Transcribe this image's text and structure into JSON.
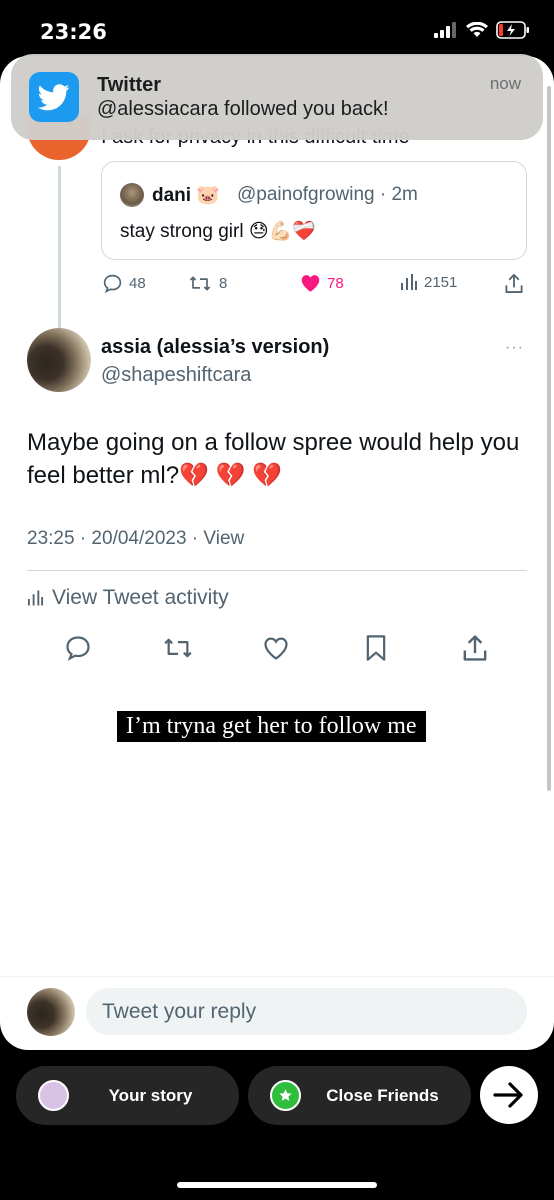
{
  "status_bar": {
    "time": "23:26"
  },
  "notification": {
    "app": "Twitter",
    "message": "@alessiacara followed you back!",
    "time": "now",
    "icon": "twitter-bird-icon"
  },
  "previous_tweet": {
    "partial_text": "I ask for privacy in this difficult time",
    "quote": {
      "name": "dani 🐷",
      "handle": "@painofgrowing · 2m",
      "text": "stay strong girl 😓💪🏻❤️‍🩹"
    },
    "actions": {
      "replies": "48",
      "retweets": "8",
      "likes": "78",
      "views": "2151"
    }
  },
  "tweet": {
    "name": "assia (alessia’s version)",
    "handle": "@shapeshiftcara",
    "text": "Maybe going on a follow spree would help you feel better ml?💔 💔 💔",
    "meta": "23:25 · 20/04/2023 · View",
    "activity_label": "View Tweet activity",
    "more": "···"
  },
  "caption": "I’m tryna get her to follow me",
  "reply": {
    "placeholder": "Tweet your reply"
  },
  "share_bar": {
    "story_label": "Your story",
    "close_friends_label": "Close Friends",
    "accent_story": "#d8c3e6",
    "accent_friends": "#2fbd3e"
  },
  "colors": {
    "like": "#f91880",
    "twitter_blue": "#1d9bf0",
    "muted": "#536471"
  }
}
